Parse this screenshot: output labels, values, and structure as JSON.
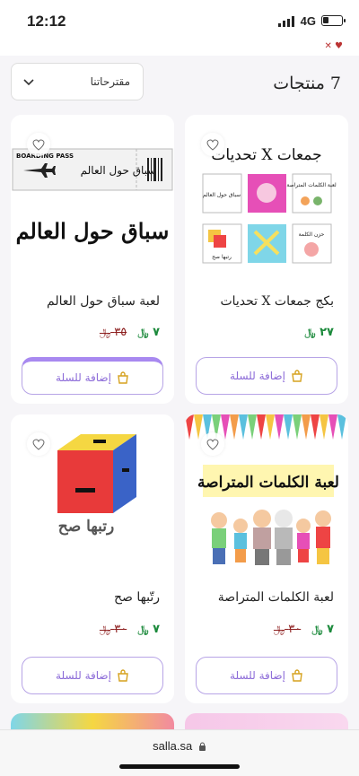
{
  "status": {
    "time": "12:12",
    "network": "4G"
  },
  "toolbar": {
    "sort_label": "مقترحاتنا",
    "count_label": "7 منتجات"
  },
  "colors": {
    "accent": "#8c6bd8",
    "price_new": "#1c8a3c",
    "price_old": "#8c1d1d"
  },
  "products": [
    {
      "name": "بكج جمعات X تحديات",
      "price": "٢٧",
      "old_price": "",
      "currency": "﷼",
      "cart_label": "إضافة للسلة",
      "image_title": "تحديات X جمعات",
      "tiles": [
        "سباق حول العالم",
        "",
        "لعبة الكلمات المتراصة",
        "رتبها صح",
        "",
        "حزن الكلمة"
      ]
    },
    {
      "name": "لعبة سباق حول العالم",
      "price": "٧",
      "old_price": "٣٥",
      "currency": "﷼",
      "cart_label": "إضافة للسلة",
      "image_title": "سباق حول العالم",
      "ticket_header": "BOARDING PASS",
      "ticket_text": "سباق حول العالم"
    },
    {
      "name": "لعبة الكلمات المتراصة",
      "price": "٧",
      "old_price": "٣٠",
      "currency": "﷼",
      "cart_label": "إضافة للسلة",
      "image_title": "لعبة الكلمات المتراصة"
    },
    {
      "name": "رتّبها صح",
      "price": "٧",
      "old_price": "٣٠",
      "currency": "﷼",
      "cart_label": "إضافة للسلة",
      "image_title": "رتبها صح"
    }
  ],
  "browser": {
    "url": "salla.sa"
  }
}
